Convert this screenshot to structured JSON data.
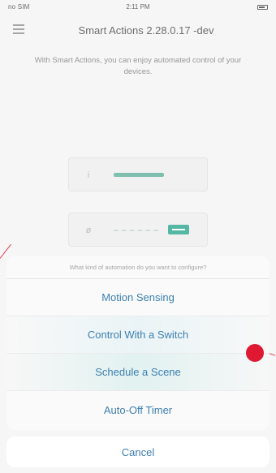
{
  "status_bar": {
    "carrier": "no SIM",
    "time": "2:11 PM",
    "battery_icon": "battery-icon"
  },
  "nav": {
    "title": "Smart Actions 2.28.0.17 -dev",
    "menu_icon": "menu-icon"
  },
  "intro_text": "With Smart Actions, you can enjoy automated control of your devices.",
  "device_cards": [
    {
      "glyph": "i"
    },
    {
      "glyph": "ø"
    }
  ],
  "action_sheet": {
    "prompt": "What kind of automation do you want to configure?",
    "options": [
      {
        "label": "Motion Sensing"
      },
      {
        "label": "Control With a Switch"
      },
      {
        "label": "Schedule a Scene"
      },
      {
        "label": "Auto-Off Timer"
      }
    ],
    "cancel_label": "Cancel"
  },
  "colors": {
    "accent_text": "#3d7fb0",
    "teal": "#3fae98",
    "annotation_red": "#e01932"
  }
}
